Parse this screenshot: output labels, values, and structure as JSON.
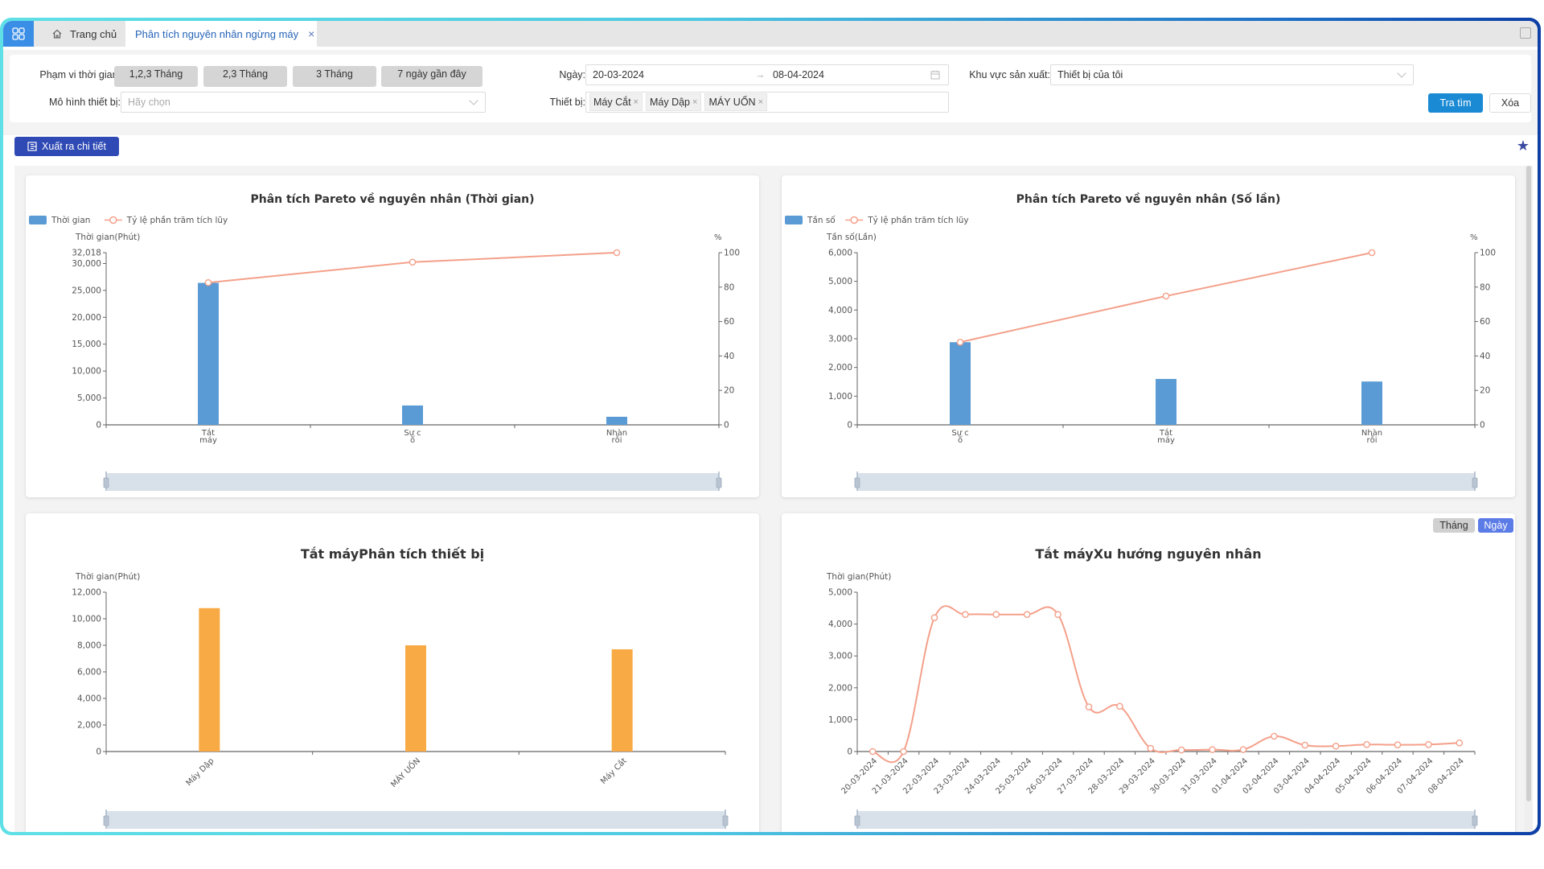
{
  "tabs": {
    "home_label": "Trang chủ",
    "active_label": "Phân tích nguyên nhân ngừng máy",
    "close_symbol": "×"
  },
  "filters": {
    "time_range_label": "Phạm vi thời gian:",
    "quick_ranges": [
      "1,2,3 Tháng",
      "2,3 Tháng",
      "3 Tháng",
      "7 ngày gần đây"
    ],
    "date_label": "Ngày:",
    "date_from": "20-03-2024",
    "date_separator": "→",
    "date_to": "08-04-2024",
    "area_label": "Khu vực sản xuất:",
    "area_value": "Thiết bị của tôi",
    "model_label": "Mô hình thiết bị:",
    "model_placeholder": "Hãy chọn",
    "device_label": "Thiết bị:",
    "device_tags": [
      "Máy Cắt",
      "Máy Dập",
      "MÁY UỐN"
    ],
    "tag_remove_symbol": "×",
    "search_button": "Tra tìm",
    "clear_button": "Xóa"
  },
  "toolbar": {
    "export_label": "Xuất ra chi tiết",
    "favorite_icon": "star-icon"
  },
  "colors": {
    "bar_blue": "#5b9bd5",
    "bar_orange": "#f8aa44",
    "line_orange": "#f4a08a",
    "primary": "#1a8ad4",
    "export": "#2f4ab5",
    "toggle_active": "#5b7be6"
  },
  "chart_data": [
    {
      "type": "bar",
      "title": "Phân tích Pareto về nguyên nhân (Thời gian)",
      "legend": [
        "Thời gian",
        "Tỷ lệ phần trăm tích lũy"
      ],
      "legend_position": "top-left",
      "categories": [
        "Tắt\nmáy",
        "Sự c\nố",
        "Nhàn\nrỗi"
      ],
      "series": [
        {
          "name": "Thời gian",
          "type": "bar",
          "axis": "left",
          "values": [
            26400,
            3600,
            1500
          ]
        },
        {
          "name": "Tỷ lệ phần trăm tích lũy",
          "type": "line",
          "axis": "right",
          "values": [
            82.6,
            94.5,
            100
          ]
        }
      ],
      "ylabel": "Thời gian(Phút)",
      "ylim": [
        0,
        32018
      ],
      "yticks": [
        "0",
        "5,000",
        "10,000",
        "15,000",
        "20,000",
        "25,000",
        "30,000",
        "32,018"
      ],
      "ytick_values": [
        0,
        5000,
        10000,
        15000,
        20000,
        25000,
        30000,
        32018
      ],
      "y2label": "%",
      "y2lim": [
        0,
        100
      ],
      "y2ticks": [
        "0",
        "20",
        "40",
        "60",
        "80",
        "100"
      ],
      "grid": false
    },
    {
      "type": "bar",
      "title": "Phân tích Pareto về nguyên nhân (Số lần)",
      "legend": [
        "Tần số",
        "Tỷ lệ phần trăm tích lũy"
      ],
      "legend_position": "top-left",
      "categories": [
        "Sự c\nố",
        "Tắt\nmáy",
        "Nhàn\nrỗi"
      ],
      "series": [
        {
          "name": "Tần số",
          "type": "bar",
          "axis": "left",
          "values": [
            2880,
            1600,
            1510
          ]
        },
        {
          "name": "Tỷ lệ phần trăm tích lũy",
          "type": "line",
          "axis": "right",
          "values": [
            48,
            74.8,
            100
          ]
        }
      ],
      "ylabel": "Tần số(Lần)",
      "ylim": [
        0,
        6000
      ],
      "yticks": [
        "0",
        "1,000",
        "2,000",
        "3,000",
        "4,000",
        "5,000",
        "6,000"
      ],
      "ytick_values": [
        0,
        1000,
        2000,
        3000,
        4000,
        5000,
        6000
      ],
      "y2label": "%",
      "y2lim": [
        0,
        100
      ],
      "y2ticks": [
        "0",
        "20",
        "40",
        "60",
        "80",
        "100"
      ],
      "grid": false
    },
    {
      "type": "bar",
      "title": "Tắt máyPhân tích thiết bị",
      "categories": [
        "Máy Dập",
        "MÁY UỐN",
        "Máy Cắt"
      ],
      "series": [
        {
          "name": "Thời gian",
          "values": [
            10800,
            8000,
            7700
          ]
        }
      ],
      "ylabel": "Thời gian(Phút)",
      "ylim": [
        0,
        12000
      ],
      "yticks": [
        "0",
        "2,000",
        "4,000",
        "6,000",
        "8,000",
        "10,000",
        "12,000"
      ],
      "ytick_values": [
        0,
        2000,
        4000,
        6000,
        8000,
        10000,
        12000
      ],
      "grid": false
    },
    {
      "type": "line",
      "title": "Tắt máyXu hướng nguyên nhân",
      "toggle": {
        "options": [
          "Tháng",
          "Ngày"
        ],
        "selected": "Ngày"
      },
      "x": [
        "20-03-2024",
        "21-03-2024",
        "22-03-2024",
        "23-03-2024",
        "24-03-2024",
        "25-03-2024",
        "26-03-2024",
        "27-03-2024",
        "28-03-2024",
        "29-03-2024",
        "30-03-2024",
        "31-03-2024",
        "01-04-2024",
        "02-04-2024",
        "03-04-2024",
        "04-04-2024",
        "05-04-2024",
        "06-04-2024",
        "07-04-2024",
        "08-04-2024"
      ],
      "series": [
        {
          "name": "Thời gian",
          "values": [
            0,
            0,
            4200,
            4300,
            4300,
            4300,
            4300,
            1400,
            1420,
            100,
            50,
            60,
            60,
            480,
            200,
            170,
            220,
            210,
            220,
            270
          ]
        }
      ],
      "ylabel": "Thời gian(Phút)",
      "ylim": [
        0,
        5000
      ],
      "yticks": [
        "0",
        "1,000",
        "2,000",
        "3,000",
        "4,000",
        "5,000"
      ],
      "ytick_values": [
        0,
        1000,
        2000,
        3000,
        4000,
        5000
      ],
      "smooth": true,
      "grid": false
    }
  ]
}
